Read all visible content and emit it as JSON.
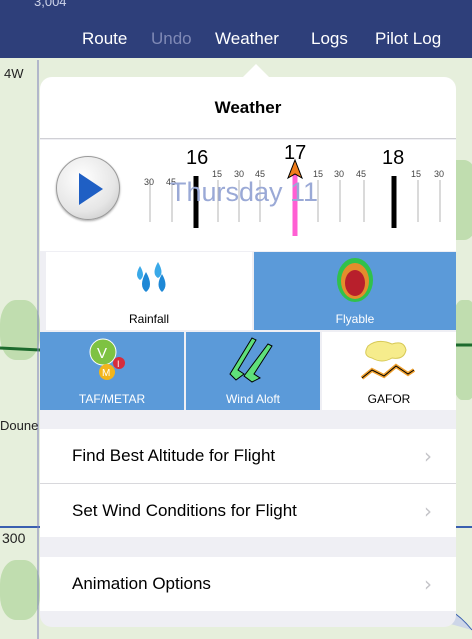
{
  "nav": {
    "partial_text": "3,004",
    "items": [
      {
        "label": "Route",
        "enabled": true
      },
      {
        "label": "Undo",
        "enabled": false
      },
      {
        "label": "Weather",
        "enabled": true
      },
      {
        "label": "Logs",
        "enabled": true
      },
      {
        "label": "Pilot Log",
        "enabled": true
      }
    ]
  },
  "map": {
    "labels": [
      "4W",
      "Doune",
      "300"
    ]
  },
  "weather": {
    "title": "Weather",
    "timeline": {
      "day": "Thursday 11",
      "hours": [
        "16",
        "17",
        "18"
      ],
      "minutes": [
        "30",
        "45",
        "15",
        "30",
        "45",
        "15",
        "30",
        "45",
        "15",
        "30"
      ],
      "current_hour": "17"
    },
    "layers": [
      {
        "label": "Rainfall",
        "selected": false,
        "icon": "rainfall-icon"
      },
      {
        "label": "Flyable",
        "selected": true,
        "icon": "flyable-icon"
      },
      {
        "label": "TAF/METAR",
        "selected": true,
        "icon": "taf-metar-icon"
      },
      {
        "label": "Wind Aloft",
        "selected": true,
        "icon": "wind-aloft-icon"
      },
      {
        "label": "GAFOR",
        "selected": false,
        "icon": "gafor-icon"
      }
    ],
    "options": [
      {
        "label": "Find Best Altitude for Flight"
      },
      {
        "label": "Set Wind Conditions for Flight"
      }
    ],
    "animation": {
      "label": "Animation Options"
    }
  },
  "colors": {
    "navbar": "#2e3f7a",
    "selected": "#5b9ad9",
    "timeline_marker": "#ff5fd3",
    "play": "#1f5fc4"
  }
}
